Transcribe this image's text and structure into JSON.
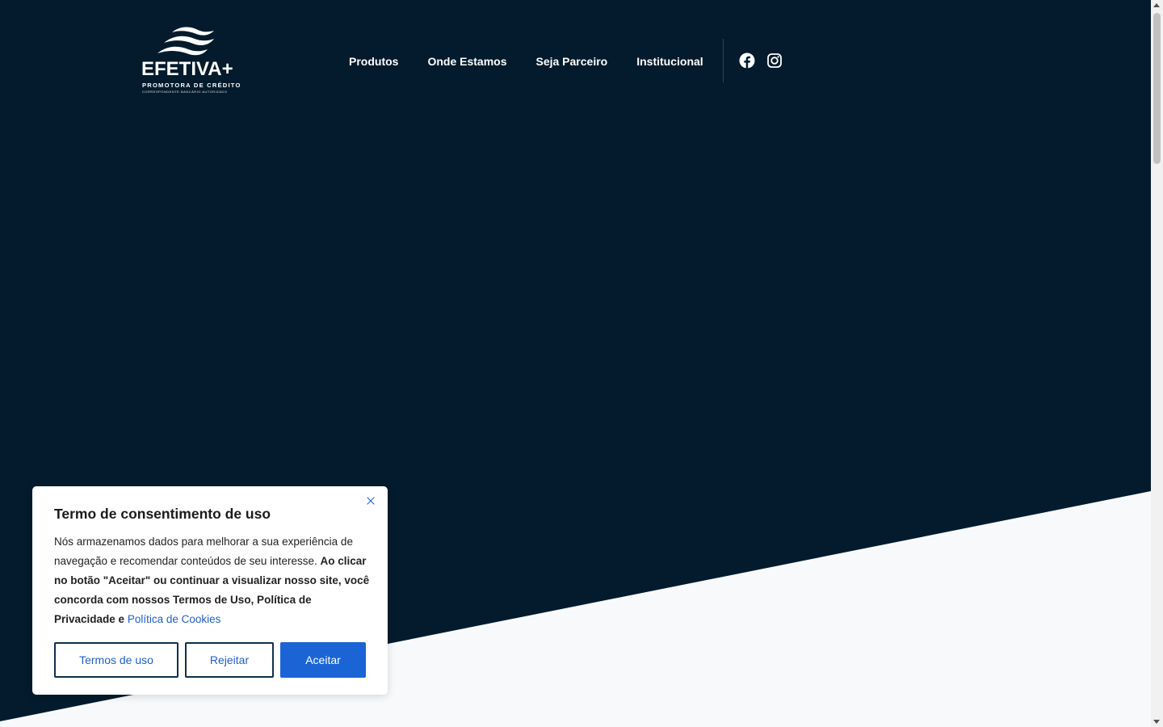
{
  "brand": {
    "name": "EFETIVA+",
    "tagline": "PROMOTORA DE CRÉDITO",
    "subtagline": "CORRESPONDENTE BANCÁRIO AUTORIZADO",
    "logo_icon": "waves-icon"
  },
  "nav": {
    "items": [
      {
        "label": "Produtos"
      },
      {
        "label": "Onde Estamos"
      },
      {
        "label": "Seja Parceiro"
      },
      {
        "label": "Institucional"
      }
    ],
    "social": [
      {
        "icon": "facebook-icon"
      },
      {
        "icon": "instagram-icon"
      }
    ]
  },
  "cookie": {
    "title": "Termo de consentimento de uso",
    "text_plain": "Nós armazenamos dados para melhorar a sua experiência de navegação e recomendar conteúdos de seu interesse. ",
    "text_bold": "Ao clicar no botão \"Aceitar\" ou continuar a visualizar nosso site, você concorda com nossos Termos de Uso, Política de Privacidade e ",
    "link_label": "Política de Cookies",
    "buttons": {
      "terms": "Termos de uso",
      "reject": "Rejeitar",
      "accept": "Aceitar"
    }
  },
  "colors": {
    "hero_dark": "#031b2c",
    "hero_light": "#f7f9fb",
    "accent": "#1a64d6",
    "link": "#1f5fc9"
  }
}
